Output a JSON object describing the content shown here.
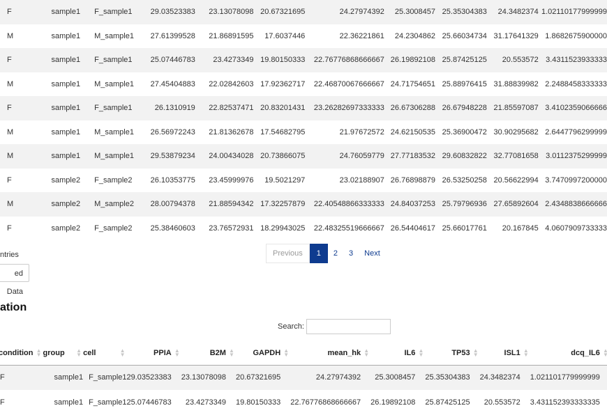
{
  "top_table": {
    "rows": [
      [
        "F",
        "sample1",
        "F_sample1",
        "29.03523383",
        "23.13078098",
        "20.67321695",
        "24.27974392",
        "25.3008457",
        "25.35304383",
        "24.3482374",
        "1.02110177999999"
      ],
      [
        "M",
        "sample1",
        "M_sample1",
        "27.61399528",
        "21.86891595",
        "17.6037446",
        "22.36221861",
        "24.2304862",
        "25.66034734",
        "31.17641329",
        "1.8682675900000"
      ],
      [
        "F",
        "sample1",
        "F_sample1",
        "25.07446783",
        "23.4273349",
        "19.80150333",
        "22.76776868666667",
        "26.19892108",
        "25.87425125",
        "20.553572",
        "3.4311523933333"
      ],
      [
        "M",
        "sample1",
        "M_sample1",
        "27.45404883",
        "22.02842603",
        "17.92362717",
        "22.46870067666667",
        "24.71754651",
        "25.88976415",
        "31.88839982",
        "2.2488458333333"
      ],
      [
        "F",
        "sample1",
        "F_sample1",
        "26.1310919",
        "22.82537471",
        "20.83201431",
        "23.26282697333333",
        "26.67306288",
        "26.67948228",
        "21.85597087",
        "3.4102359066666"
      ],
      [
        "M",
        "sample1",
        "M_sample1",
        "26.56972243",
        "21.81362678",
        "17.54682795",
        "21.97672572",
        "24.62150535",
        "25.36900472",
        "30.90295682",
        "2.6447796299999"
      ],
      [
        "M",
        "sample1",
        "M_sample1",
        "29.53879234",
        "24.00434028",
        "20.73866075",
        "24.76059779",
        "27.77183532",
        "29.60832822",
        "32.77081658",
        "3.0112375299999"
      ],
      [
        "F",
        "sample2",
        "F_sample2",
        "26.10353775",
        "23.45999976",
        "19.5021297",
        "23.02188907",
        "26.76898879",
        "26.53250258",
        "20.56622994",
        "3.7470997200000"
      ],
      [
        "M",
        "sample2",
        "M_sample2",
        "28.00794378",
        "21.88594342",
        "17.32257879",
        "22.40548866333333",
        "24.84037253",
        "25.79796936",
        "27.65892604",
        "2.4348838666666"
      ],
      [
        "F",
        "sample2",
        "F_sample2",
        "25.38460603",
        "23.76572931",
        "18.29943025",
        "22.48325519666667",
        "26.54404617",
        "25.66017761",
        "20.167845",
        "4.0607909733333"
      ]
    ]
  },
  "entries_text": "ntries",
  "pagination": {
    "previous": "Previous",
    "pages": [
      "1",
      "2",
      "3"
    ],
    "current": "1",
    "next": "Next"
  },
  "download_button": "ed Data",
  "section_title": "ation",
  "search": {
    "label": "Search:",
    "value": ""
  },
  "bottom_table": {
    "headers": [
      "condition",
      "group",
      "cell",
      "PPIA",
      "B2M",
      "GAPDH",
      "mean_hk",
      "IL6",
      "TP53",
      "ISL1",
      "dcq_IL6"
    ],
    "rows": [
      [
        "F",
        "sample1",
        "F_sample1",
        "29.03523383",
        "23.13078098",
        "20.67321695",
        "24.27974392",
        "25.3008457",
        "25.35304383",
        "24.3482374",
        "1.021101779999999"
      ],
      [
        "F",
        "sample1",
        "F_sample1",
        "25.07446783",
        "23.4273349",
        "19.80150333",
        "22.76776868666667",
        "26.19892108",
        "25.87425125",
        "20.553572",
        "3.431152393333335"
      ]
    ]
  }
}
